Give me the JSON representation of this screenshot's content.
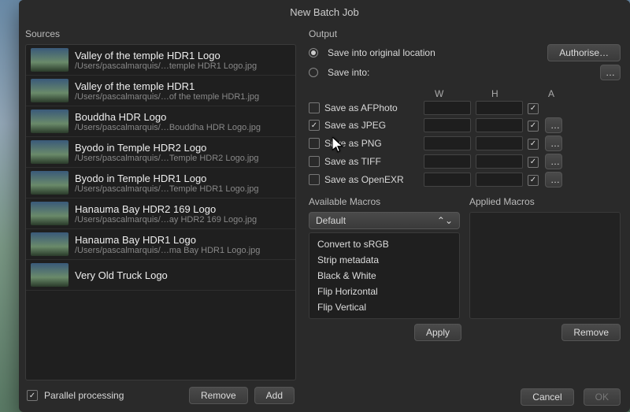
{
  "title": "New Batch Job",
  "left": {
    "section": "Sources",
    "items": [
      {
        "title": "Valley of the temple HDR1 Logo",
        "path": "/Users/pascalmarquis/…temple HDR1 Logo.jpg"
      },
      {
        "title": "Valley of the temple HDR1",
        "path": "/Users/pascalmarquis/…of the temple HDR1.jpg"
      },
      {
        "title": "Bouddha HDR Logo",
        "path": "/Users/pascalmarquis/…Bouddha HDR Logo.jpg"
      },
      {
        "title": "Byodo in Temple HDR2 Logo",
        "path": "/Users/pascalmarquis/…Temple HDR2 Logo.jpg"
      },
      {
        "title": "Byodo in Temple HDR1 Logo",
        "path": "/Users/pascalmarquis/…Temple HDR1 Logo.jpg"
      },
      {
        "title": "Hanauma Bay HDR2 169 Logo",
        "path": "/Users/pascalmarquis/…ay HDR2 169 Logo.jpg"
      },
      {
        "title": "Hanauma Bay HDR1 Logo",
        "path": "/Users/pascalmarquis/…ma Bay HDR1 Logo.jpg"
      },
      {
        "title": "Very Old Truck Logo",
        "path": ""
      }
    ],
    "parallel_label": "Parallel processing",
    "parallel_checked": true,
    "remove_btn": "Remove",
    "add_btn": "Add"
  },
  "output": {
    "section": "Output",
    "radio_original": "Save into original location",
    "radio_into": "Save into:",
    "selected_radio": "original",
    "authorise_btn": "Authorise…",
    "browse_btn": "…",
    "col_w": "W",
    "col_h": "H",
    "col_a": "A",
    "formats": [
      {
        "label": "Save as AFPhoto",
        "checked": false,
        "a": true,
        "has_opts": false
      },
      {
        "label": "Save as JPEG",
        "checked": true,
        "a": true,
        "has_opts": true
      },
      {
        "label": "Save as PNG",
        "checked": false,
        "a": true,
        "has_opts": true
      },
      {
        "label": "Save as TIFF",
        "checked": false,
        "a": true,
        "has_opts": true
      },
      {
        "label": "Save as OpenEXR",
        "checked": false,
        "a": true,
        "has_opts": true
      }
    ]
  },
  "macros": {
    "available_label": "Available Macros",
    "applied_label": "Applied Macros",
    "library_select": "Default",
    "available": [
      "Convert to sRGB",
      "Strip metadata",
      "Black & White",
      "Flip Horizontal",
      "Flip Vertical"
    ],
    "apply_btn": "Apply",
    "remove_btn": "Remove"
  },
  "footer": {
    "cancel": "Cancel",
    "ok": "OK"
  }
}
